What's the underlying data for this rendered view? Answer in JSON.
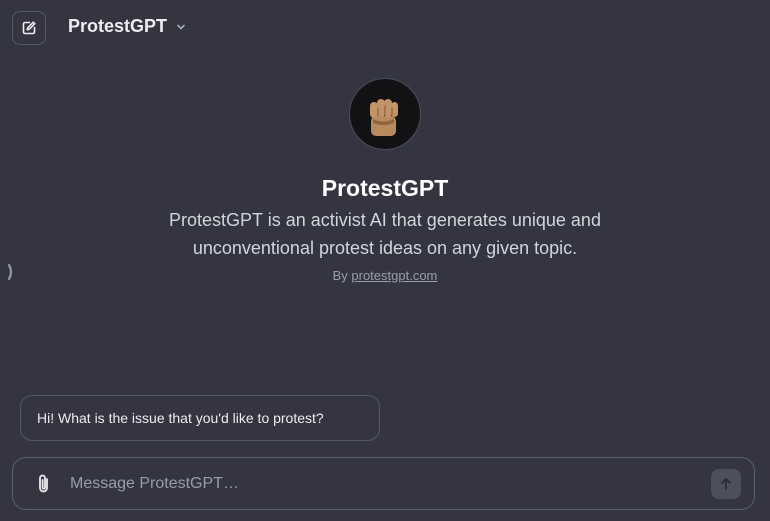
{
  "header": {
    "new_chat_icon": "pencil-square-icon",
    "model_name": "ProtestGPT",
    "dropdown_icon": "chevron-down-icon"
  },
  "sidebar_toggle_icon": "chevron-right-icon",
  "gpt": {
    "avatar_icon": "raised-fist-icon",
    "name": "ProtestGPT",
    "description": "ProtestGPT is an activist AI that generates unique and unconventional protest ideas on any given topic.",
    "author_prefix": "By",
    "author_link": "protestgpt.com"
  },
  "conversation_starters": [
    "Hi! What is the issue that you'd like to protest?"
  ],
  "composer": {
    "attach_icon": "paperclip-icon",
    "placeholder": "Message ProtestGPT…",
    "send_icon": "arrow-up-icon"
  },
  "colors": {
    "background": "#343541",
    "border": "#565869",
    "text": "#ececf1",
    "muted_text": "#9a9cac",
    "skin_tone": "#b98a60"
  }
}
